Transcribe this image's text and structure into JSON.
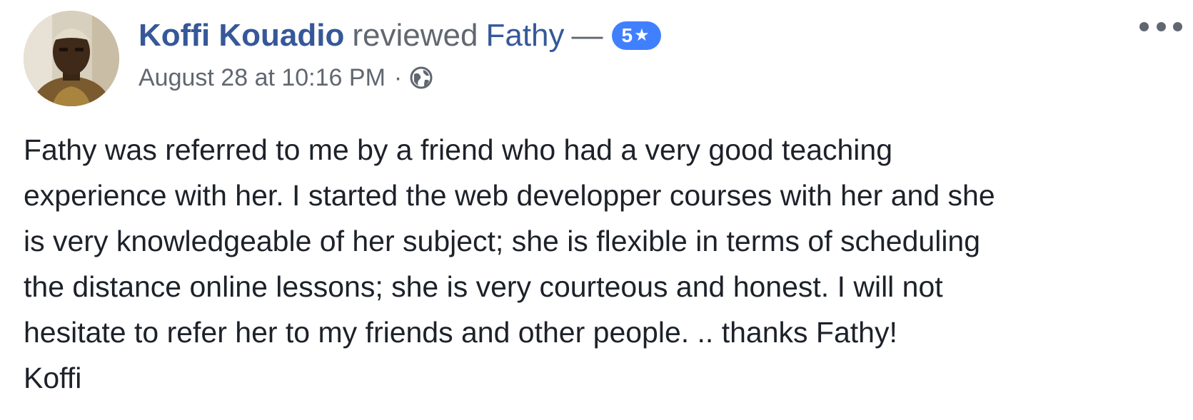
{
  "post": {
    "author": "Koffi Kouadio",
    "action": "reviewed",
    "target": "Fathy",
    "dash": "—",
    "rating": {
      "value": "5",
      "star": "★",
      "color": "#4080ff"
    },
    "timestamp": "August 28 at 10:16 PM",
    "separator": "·",
    "audience_icon": "globe-icon",
    "menu_icon": "more-options-icon",
    "body": "Fathy was referred to me by a friend who had a very good teaching\nexperience with her. I started the web developper courses with her and she\nis very knowledgeable of her subject; she is flexible in terms of scheduling\nthe distance online lessons; she is very courteous and honest. I will not\nhesitate to refer her to my friends and other people. .. thanks Fathy!\nKoffi"
  },
  "colors": {
    "link": "#365899",
    "secondary_text": "#616770",
    "body_text": "#1d2129"
  }
}
